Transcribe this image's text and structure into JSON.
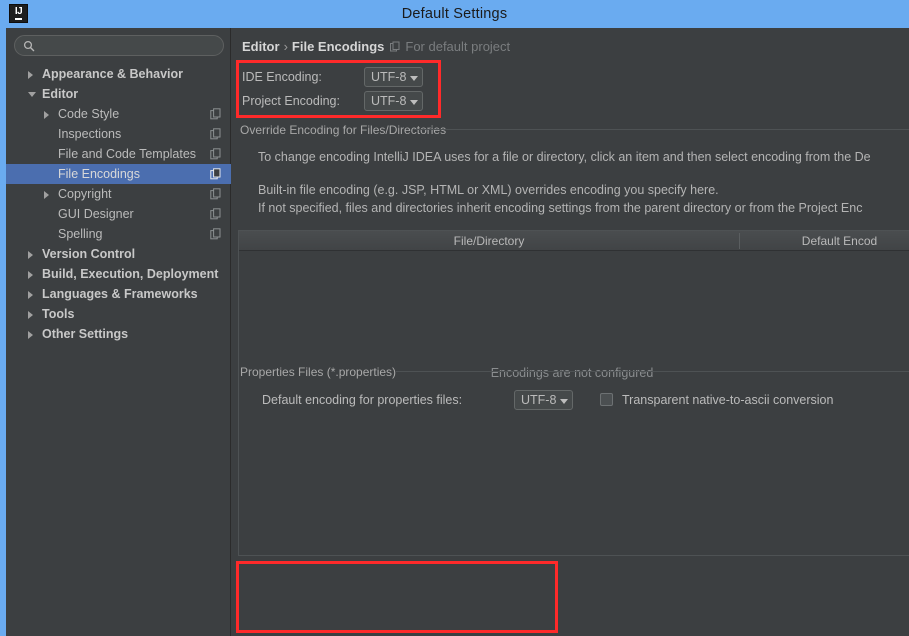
{
  "window": {
    "title": "Default Settings",
    "app_icon": "IJ",
    "titlebar_color": "#6aabf0"
  },
  "sidebar": {
    "search": {
      "value": "",
      "placeholder": "",
      "icon": "search-icon"
    },
    "items": [
      {
        "label": "Appearance & Behavior",
        "depth": 0,
        "arrow": "right",
        "bold": true,
        "selected": false,
        "copy_icon": false
      },
      {
        "label": "Editor",
        "depth": 0,
        "arrow": "down",
        "bold": true,
        "selected": false,
        "copy_icon": false
      },
      {
        "label": "Code Style",
        "depth": 1,
        "arrow": "right",
        "bold": false,
        "selected": false,
        "copy_icon": true
      },
      {
        "label": "Inspections",
        "depth": 1,
        "arrow": "none",
        "bold": false,
        "selected": false,
        "copy_icon": true
      },
      {
        "label": "File and Code Templates",
        "depth": 1,
        "arrow": "none",
        "bold": false,
        "selected": false,
        "copy_icon": true
      },
      {
        "label": "File Encodings",
        "depth": 1,
        "arrow": "none",
        "bold": false,
        "selected": true,
        "copy_icon": true
      },
      {
        "label": "Copyright",
        "depth": 1,
        "arrow": "right",
        "bold": false,
        "selected": false,
        "copy_icon": true
      },
      {
        "label": "GUI Designer",
        "depth": 1,
        "arrow": "none",
        "bold": false,
        "selected": false,
        "copy_icon": true
      },
      {
        "label": "Spelling",
        "depth": 1,
        "arrow": "none",
        "bold": false,
        "selected": false,
        "copy_icon": true
      },
      {
        "label": "Version Control",
        "depth": 0,
        "arrow": "right",
        "bold": true,
        "selected": false,
        "copy_icon": false
      },
      {
        "label": "Build, Execution, Deployment",
        "depth": 0,
        "arrow": "right",
        "bold": true,
        "selected": false,
        "copy_icon": false
      },
      {
        "label": "Languages & Frameworks",
        "depth": 0,
        "arrow": "right",
        "bold": true,
        "selected": false,
        "copy_icon": false
      },
      {
        "label": "Tools",
        "depth": 0,
        "arrow": "right",
        "bold": true,
        "selected": false,
        "copy_icon": false
      },
      {
        "label": "Other Settings",
        "depth": 0,
        "arrow": "right",
        "bold": true,
        "selected": false,
        "copy_icon": false
      }
    ]
  },
  "panel": {
    "breadcrumb": {
      "parent": "Editor",
      "separator": "›",
      "current": "File Encodings",
      "project_hint": "For default project",
      "project_icon": "project-icon"
    },
    "ide_encoding": {
      "label": "IDE Encoding:",
      "value": "UTF-8"
    },
    "project_encoding": {
      "label": "Project Encoding:",
      "value": "UTF-8"
    },
    "override_group": {
      "title": "Override Encoding for Files/Directories",
      "line1": "To change encoding IntelliJ IDEA uses for a file or directory, click an item and then select encoding from the De",
      "line2": "Built-in file encoding (e.g. JSP, HTML or XML) overrides encoding you specify here.",
      "line3": "If not specified, files and directories inherit encoding settings from the parent directory or from the Project Enc"
    },
    "table": {
      "columns": [
        "File/Directory",
        "Default Encod"
      ],
      "empty_message": "Encodings are not configured",
      "rows": []
    },
    "properties_group": {
      "title": "Properties Files (*.properties)",
      "default_encoding_label": "Default encoding for properties files:",
      "default_encoding_value": "UTF-8",
      "transparent_label": "Transparent native-to-ascii conversion",
      "transparent_checked": false
    }
  },
  "annotations": {
    "highlight_color": "#ff2a2a",
    "boxes": [
      "encoding-fields-highlight",
      "properties-files-highlight"
    ]
  }
}
